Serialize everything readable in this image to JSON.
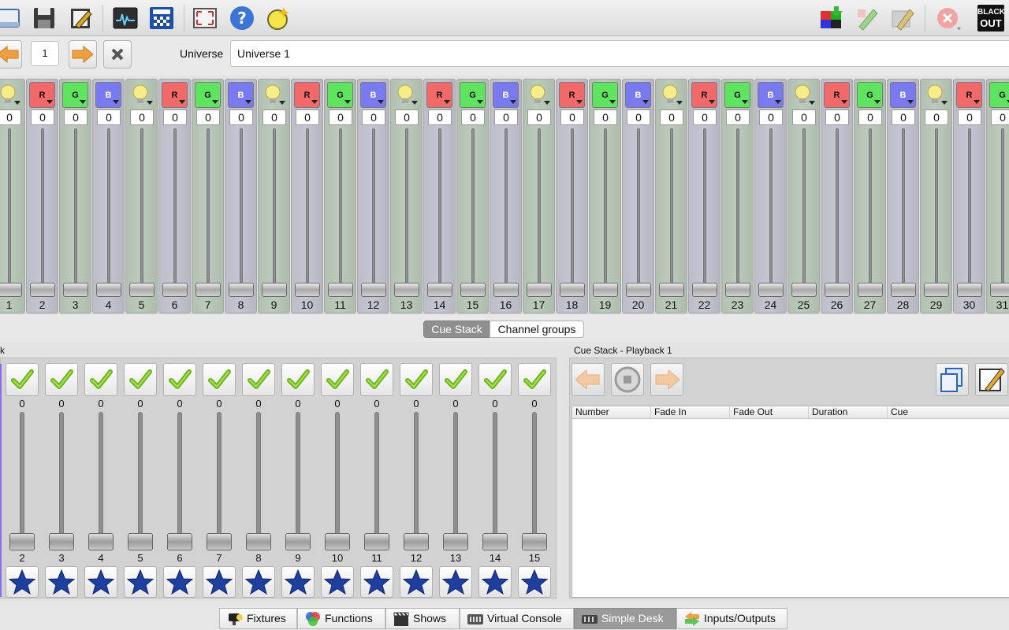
{
  "toolbar": {
    "left_icons": [
      "new-icon",
      "save-icon",
      "edit-icon",
      "monitor-icon",
      "dmx-dump-icon",
      "fullscreen-icon",
      "help-icon",
      "bulb-add-icon"
    ],
    "right_icons": [
      "fixture-add-icon",
      "pencil-green-icon",
      "pencil-grey-icon",
      "close-icon"
    ],
    "blackout_line1": "BLACK",
    "blackout_line2": "OUT"
  },
  "universe_bar": {
    "page": "1",
    "label": "Universe",
    "value": "Universe 1"
  },
  "channels": [
    {
      "num": "1",
      "type": "i",
      "value": "0"
    },
    {
      "num": "2",
      "type": "r",
      "value": "0",
      "letter": "R"
    },
    {
      "num": "3",
      "type": "g",
      "value": "0",
      "letter": "G"
    },
    {
      "num": "4",
      "type": "b",
      "value": "0",
      "letter": "B"
    },
    {
      "num": "5",
      "type": "i",
      "value": "0"
    },
    {
      "num": "6",
      "type": "r",
      "value": "0",
      "letter": "R"
    },
    {
      "num": "7",
      "type": "g",
      "value": "0",
      "letter": "G"
    },
    {
      "num": "8",
      "type": "b",
      "value": "0",
      "letter": "B"
    },
    {
      "num": "9",
      "type": "i",
      "value": "0"
    },
    {
      "num": "10",
      "type": "r",
      "value": "0",
      "letter": "R"
    },
    {
      "num": "11",
      "type": "g",
      "value": "0",
      "letter": "G"
    },
    {
      "num": "12",
      "type": "b",
      "value": "0",
      "letter": "B"
    },
    {
      "num": "13",
      "type": "i",
      "value": "0"
    },
    {
      "num": "14",
      "type": "r",
      "value": "0",
      "letter": "R"
    },
    {
      "num": "15",
      "type": "g",
      "value": "0",
      "letter": "G"
    },
    {
      "num": "16",
      "type": "b",
      "value": "0",
      "letter": "B"
    },
    {
      "num": "17",
      "type": "i",
      "value": "0"
    },
    {
      "num": "18",
      "type": "r",
      "value": "0",
      "letter": "R"
    },
    {
      "num": "19",
      "type": "g",
      "value": "0",
      "letter": "G"
    },
    {
      "num": "20",
      "type": "b",
      "value": "0",
      "letter": "B"
    },
    {
      "num": "21",
      "type": "i",
      "value": "0"
    },
    {
      "num": "22",
      "type": "r",
      "value": "0",
      "letter": "R"
    },
    {
      "num": "23",
      "type": "g",
      "value": "0",
      "letter": "G"
    },
    {
      "num": "24",
      "type": "b",
      "value": "0",
      "letter": "B"
    },
    {
      "num": "25",
      "type": "i",
      "value": "0"
    },
    {
      "num": "26",
      "type": "r",
      "value": "0",
      "letter": "R"
    },
    {
      "num": "27",
      "type": "g",
      "value": "0",
      "letter": "G"
    },
    {
      "num": "28",
      "type": "b",
      "value": "0",
      "letter": "B"
    },
    {
      "num": "29",
      "type": "i",
      "value": "0"
    },
    {
      "num": "30",
      "type": "r",
      "value": "0",
      "letter": "R"
    },
    {
      "num": "31",
      "type": "g",
      "value": "0",
      "letter": "G"
    }
  ],
  "middle_tabs": {
    "cue_stack": "Cue Stack",
    "channel_groups": "Channel groups"
  },
  "playback_panel": {
    "title": "k",
    "playbacks": [
      {
        "num": "2",
        "value": "0"
      },
      {
        "num": "3",
        "value": "0"
      },
      {
        "num": "4",
        "value": "0"
      },
      {
        "num": "5",
        "value": "0"
      },
      {
        "num": "6",
        "value": "0"
      },
      {
        "num": "7",
        "value": "0"
      },
      {
        "num": "8",
        "value": "0"
      },
      {
        "num": "9",
        "value": "0"
      },
      {
        "num": "10",
        "value": "0"
      },
      {
        "num": "11",
        "value": "0"
      },
      {
        "num": "12",
        "value": "0"
      },
      {
        "num": "13",
        "value": "0"
      },
      {
        "num": "14",
        "value": "0"
      },
      {
        "num": "15",
        "value": "0"
      }
    ]
  },
  "cue_stack": {
    "title": "Cue Stack - Playback 1",
    "columns": [
      "Number",
      "Fade In",
      "Fade Out",
      "Duration",
      "Cue"
    ]
  },
  "bottom_tabs": [
    {
      "label": "Fixtures",
      "icon": "fixtures-icon",
      "active": false
    },
    {
      "label": "Functions",
      "icon": "functions-icon",
      "active": false
    },
    {
      "label": "Shows",
      "icon": "shows-icon",
      "active": false
    },
    {
      "label": "Virtual Console",
      "icon": "virtual-console-icon",
      "active": false
    },
    {
      "label": "Simple Desk",
      "icon": "simple-desk-icon",
      "active": true
    },
    {
      "label": "Inputs/Outputs",
      "icon": "inputs-outputs-icon",
      "active": false
    }
  ],
  "colors": {
    "red_channel": "#f26969",
    "green_channel": "#5fe45f",
    "blue_channel": "#7a7af0",
    "active_tab": "#9a9a9a",
    "accent": "#8a6cf0"
  }
}
